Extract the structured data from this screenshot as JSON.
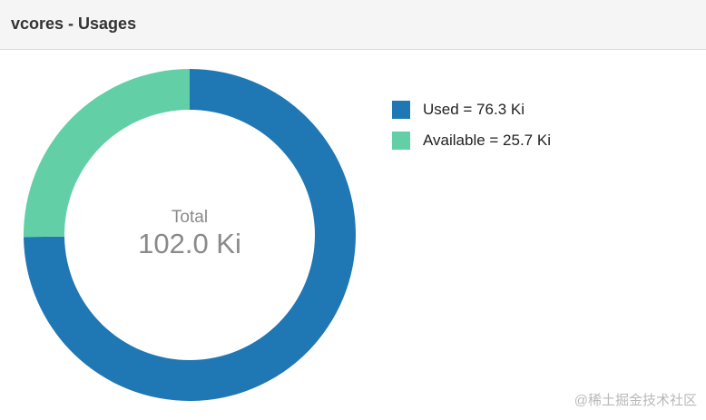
{
  "panel": {
    "title": "vcores - Usages"
  },
  "chart_data": {
    "type": "pie",
    "center_label": "Total",
    "center_value": "102.0 Ki",
    "slices": [
      {
        "name": "Used",
        "value": 76.3,
        "color": "#1f77b4",
        "legend_label": "Used = 76.3 Ki"
      },
      {
        "name": "Available",
        "value": 25.7,
        "color": "#62cfa6",
        "legend_label": "Available = 25.7 Ki"
      }
    ],
    "legend_position": "right"
  },
  "watermark": "@稀土掘金技术社区"
}
